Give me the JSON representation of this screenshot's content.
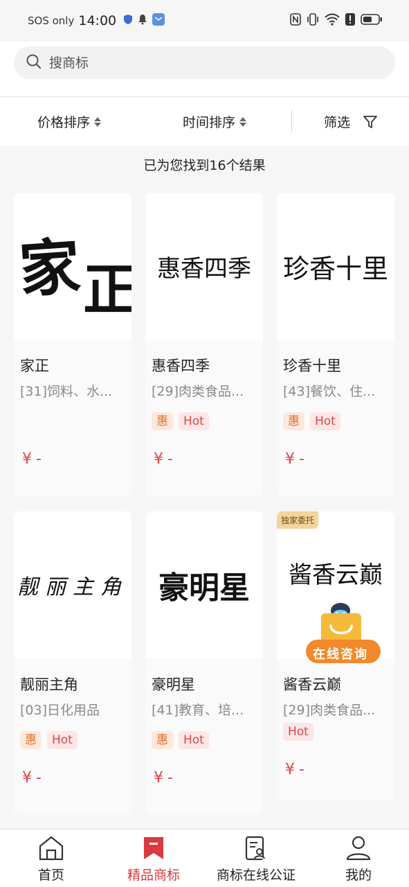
{
  "status_bar": {
    "carrier": "SOS only",
    "time": "14:00"
  },
  "search": {
    "placeholder": "搜商标"
  },
  "sort_bar": {
    "price_sort": "价格排序",
    "time_sort": "时间排序",
    "filter": "筛选"
  },
  "result_count": "已为您找到16个结果",
  "cards": [
    {
      "logo": "家正",
      "name": "家正",
      "class": "[31]饲料、水...",
      "tags": [],
      "price": "¥-"
    },
    {
      "logo": "惠香四季",
      "name": "惠香四季",
      "class": "[29]肉类食品...",
      "tags": [
        "惠",
        "Hot"
      ],
      "price": "¥-"
    },
    {
      "logo": "珍香十里",
      "name": "珍香十里",
      "class": "[43]餐饮、住...",
      "tags": [
        "惠",
        "Hot"
      ],
      "price": "¥-"
    },
    {
      "logo": "靓丽主角",
      "name": "靓丽主角",
      "class": "[03]日化用品",
      "tags": [
        "惠",
        "Hot"
      ],
      "price": "¥-"
    },
    {
      "logo": "豪明星",
      "name": "豪明星",
      "class": "[41]教育、培...",
      "tags": [
        "惠",
        "Hot"
      ],
      "price": "¥-"
    },
    {
      "logo": "酱香云巅",
      "name": "酱香云巅",
      "class": "[29]肉类食品...",
      "tags": [
        "Hot"
      ],
      "price": "¥-",
      "badge": "独家委托"
    }
  ],
  "consult_label": "在线咨询",
  "bottom_nav": [
    {
      "label": "首页",
      "icon": "home-icon"
    },
    {
      "label": "精品商标",
      "icon": "bookmark-icon",
      "active": true
    },
    {
      "label": "商标在线公证",
      "icon": "document-icon"
    },
    {
      "label": "我的",
      "icon": "profile-icon"
    }
  ],
  "colors": {
    "accent": "#d93a3e",
    "price": "#e0444a",
    "hui_tag": "#e0702a",
    "hot_tag": "#d84848"
  }
}
